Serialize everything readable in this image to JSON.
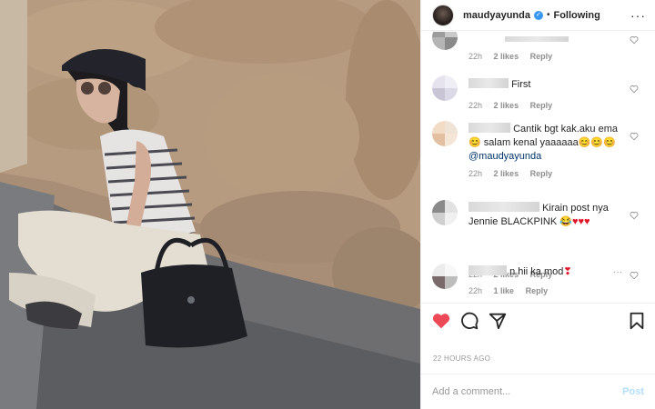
{
  "post": {
    "username": "maudyayunda",
    "separator": "•",
    "follow_status": "Following",
    "more_icon": "more-horizontal-icon",
    "timestamp": "22 HOURS AGO"
  },
  "comments": [
    {
      "user_redacted": true,
      "text": "",
      "time": "22h",
      "likes": "2 likes",
      "reply": "Reply"
    },
    {
      "user_redacted": true,
      "text": "First",
      "time": "22h",
      "likes": "2 likes",
      "reply": "Reply"
    },
    {
      "user_redacted": true,
      "text": "Cantik bgt kak.aku ema",
      "text2": "salam kenal yaaaaaa",
      "mention": "@maudyayunda",
      "time": "22h",
      "likes": "2 likes",
      "reply": "Reply"
    },
    {
      "user_redacted": true,
      "text": "Kirain post nya",
      "text2": "Jennie BLACKPINK",
      "time": "22h",
      "likes": "2 likes",
      "reply": "Reply"
    },
    {
      "user_redacted": true,
      "text": "n hii ka mod",
      "time": "22h",
      "likes": "1 like",
      "reply": "Reply"
    }
  ],
  "actions": {
    "like_icon": "heart-filled-icon",
    "comment_icon": "comment-bubble-icon",
    "share_icon": "paper-plane-icon",
    "save_icon": "bookmark-icon"
  },
  "composer": {
    "placeholder": "Add a comment...",
    "post_label": "Post"
  },
  "colors": {
    "like_red": "#ed4956",
    "verified_blue": "#3897f0",
    "meta_gray": "#8e8e8e",
    "post_disabled": "#b2dffc"
  }
}
